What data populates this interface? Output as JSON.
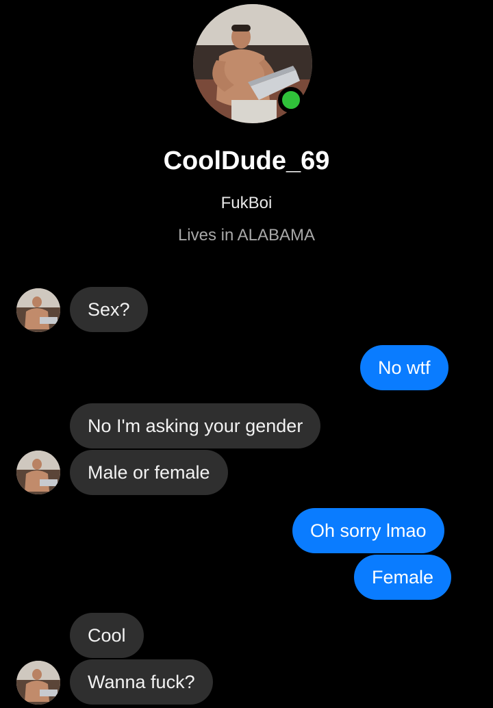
{
  "profile": {
    "name": "CoolDude_69",
    "nickname": "FukBoi",
    "location": "Lives in ALABAMA",
    "photo_icon": "profile-photo-shirtless-man-laptop",
    "presence_color": "#30c23a"
  },
  "colors": {
    "background": "#000000",
    "incoming_bubble": "#2f2f2f",
    "outgoing_bubble": "#0a7cff"
  },
  "messages": [
    {
      "sender": "them",
      "text": "Sex?"
    },
    {
      "sender": "me",
      "text": "No wtf"
    },
    {
      "sender": "them",
      "text": "No I'm asking your gender"
    },
    {
      "sender": "them",
      "text": "Male or female"
    },
    {
      "sender": "me",
      "text": "Oh sorry lmao"
    },
    {
      "sender": "me",
      "text": "Female"
    },
    {
      "sender": "them",
      "text": "Cool"
    },
    {
      "sender": "them",
      "text": "Wanna fuck?"
    }
  ]
}
